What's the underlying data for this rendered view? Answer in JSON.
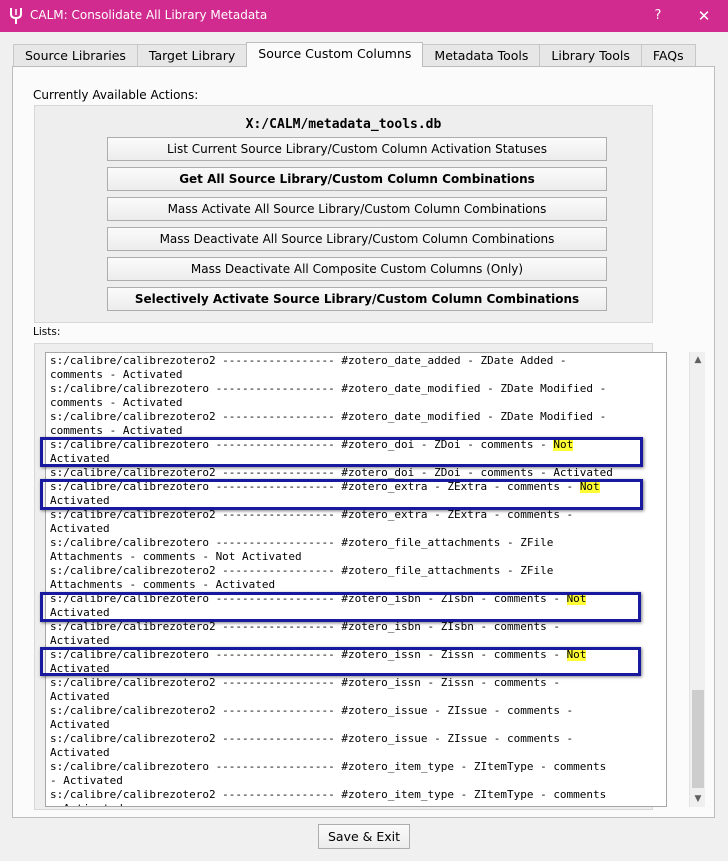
{
  "window": {
    "title": "CALM: Consolidate All Library Metadata",
    "help_label": "?",
    "close_label": "✕",
    "titlebar_color": "#d12b8f",
    "icon": "tuning-fork-icon"
  },
  "tabs": [
    {
      "label": "Source Libraries",
      "active": false
    },
    {
      "label": "Target Library",
      "active": false
    },
    {
      "label": "Source Custom Columns",
      "active": true
    },
    {
      "label": "Metadata Tools",
      "active": false
    },
    {
      "label": "Library Tools",
      "active": false
    },
    {
      "label": "FAQs",
      "active": false
    }
  ],
  "actions": {
    "label": "Currently Available Actions:",
    "db_path": "X:/CALM/metadata_tools.db",
    "buttons": [
      {
        "label": "List Current Source Library/Custom Column Activation Statuses",
        "bold": false
      },
      {
        "label": "Get All Source Library/Custom Column Combinations",
        "bold": true
      },
      {
        "label": "Mass Activate All Source Library/Custom Column Combinations",
        "bold": false
      },
      {
        "label": "Mass Deactivate All Source Library/Custom Column Combinations",
        "bold": false
      },
      {
        "label": "Mass Deactivate All Composite Custom Columns (Only)",
        "bold": false
      },
      {
        "label": "Selectively Activate Source Library/Custom Column Combinations",
        "bold": true
      }
    ]
  },
  "lists": {
    "label": "Lists:",
    "highlight_color": "#ffff33",
    "box_color": "#1919a0",
    "lines": [
      {
        "text": "s:/calibre/calibrezotero2 ----------------- #zotero_date_added - ZDate Added -"
      },
      {
        "text": "comments - Activated"
      },
      {
        "text": "s:/calibre/calibrezotero ------------------ #zotero_date_modified - ZDate Modified -"
      },
      {
        "text": "comments - Activated"
      },
      {
        "text": "s:/calibre/calibrezotero2 ----------------- #zotero_date_modified - ZDate Modified -"
      },
      {
        "text": "comments - Activated"
      },
      {
        "text": "s:/calibre/calibrezotero ------------------ #zotero_doi - ZDoi - comments - ",
        "highlight": "Not"
      },
      {
        "text": "Activated"
      },
      {
        "text": "s:/calibre/calibrezotero2 ----------------- #zotero_doi - ZDoi - comments - Activated"
      },
      {
        "text": "s:/calibre/calibrezotero ------------------ #zotero_extra - ZExtra - comments - ",
        "highlight": "Not"
      },
      {
        "text": "Activated"
      },
      {
        "text": "s:/calibre/calibrezotero2 ----------------- #zotero_extra - ZExtra - comments -"
      },
      {
        "text": "Activated"
      },
      {
        "text": "s:/calibre/calibrezotero ------------------ #zotero_file_attachments - ZFile"
      },
      {
        "text": "Attachments - comments - Not Activated"
      },
      {
        "text": "s:/calibre/calibrezotero2 ----------------- #zotero_file_attachments - ZFile"
      },
      {
        "text": "Attachments - comments - Activated"
      },
      {
        "text": "s:/calibre/calibrezotero ------------------ #zotero_isbn - ZIsbn - comments - ",
        "highlight": "Not"
      },
      {
        "text": "Activated"
      },
      {
        "text": "s:/calibre/calibrezotero2 ----------------- #zotero_isbn - ZIsbn - comments -"
      },
      {
        "text": "Activated"
      },
      {
        "text": "s:/calibre/calibrezotero ------------------ #zotero_issn - Zissn - comments - ",
        "highlight": "Not"
      },
      {
        "text": "Activated"
      },
      {
        "text": "s:/calibre/calibrezotero2 ----------------- #zotero_issn - Zissn - comments -"
      },
      {
        "text": "Activated"
      },
      {
        "text": "s:/calibre/calibrezotero2 ----------------- #zotero_issue - ZIssue - comments -"
      },
      {
        "text": "Activated"
      },
      {
        "text": "s:/calibre/calibrezotero2 ----------------- #zotero_issue - ZIssue - comments -"
      },
      {
        "text": "Activated"
      },
      {
        "text": "s:/calibre/calibrezotero ------------------ #zotero_item_type - ZItemType - comments"
      },
      {
        "text": "- Activated"
      },
      {
        "text": "s:/calibre/calibrezotero2 ----------------- #zotero_item_type - ZItemType - comments"
      },
      {
        "text": "- Activated"
      }
    ]
  },
  "footer": {
    "save_label": "Save & Exit"
  }
}
